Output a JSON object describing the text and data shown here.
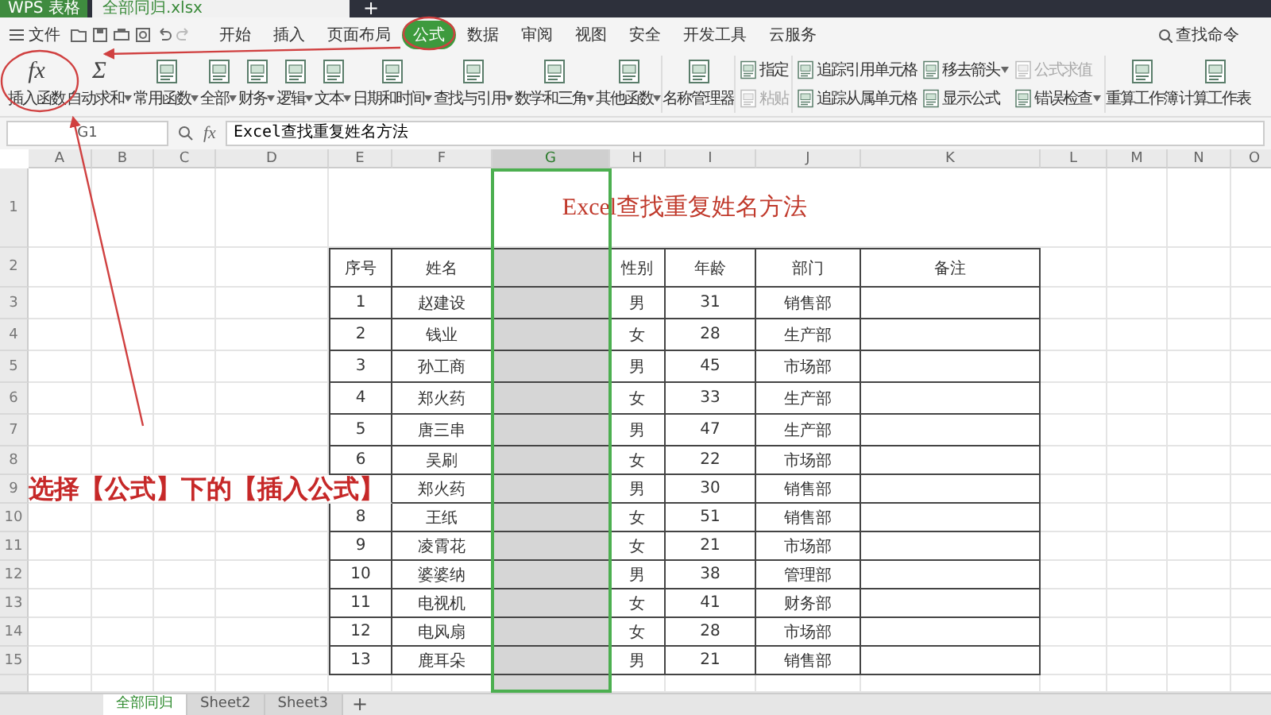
{
  "title_bar": {
    "app_tab": "WPS 表格",
    "doc_tab": "全部同归.xlsx",
    "new_tab": "+"
  },
  "menu": {
    "file": "文件",
    "tabs": [
      {
        "label": "开始",
        "selected": false
      },
      {
        "label": "插入",
        "selected": false
      },
      {
        "label": "页面布局",
        "selected": false
      },
      {
        "label": "公式",
        "selected": true,
        "circled": true
      },
      {
        "label": "数据",
        "selected": false
      },
      {
        "label": "审阅",
        "selected": false
      },
      {
        "label": "视图",
        "selected": false
      },
      {
        "label": "安全",
        "selected": false
      },
      {
        "label": "开发工具",
        "selected": false
      },
      {
        "label": "云服务",
        "selected": false
      }
    ],
    "search": "查找命令"
  },
  "ribbon": {
    "sections": [
      {
        "kind": "large",
        "items": [
          {
            "label": "插入函数",
            "glyph": "fx",
            "circled": true
          },
          {
            "label": "自动求和",
            "glyph": "Σ",
            "dropdown": true
          },
          {
            "label": "常用函数",
            "dropdown": true
          },
          {
            "label": "全部",
            "dropdown": true
          },
          {
            "label": "财务",
            "dropdown": true
          },
          {
            "label": "逻辑",
            "dropdown": true
          },
          {
            "label": "文本",
            "dropdown": true
          },
          {
            "label": "日期和时间",
            "dropdown": true
          },
          {
            "label": "查找与引用",
            "dropdown": true
          },
          {
            "label": "数学和三角",
            "dropdown": true
          },
          {
            "label": "其他函数",
            "dropdown": true
          }
        ]
      },
      {
        "kind": "large",
        "items": [
          {
            "label": "名称管理器"
          }
        ]
      },
      {
        "kind": "stack",
        "items": [
          {
            "label": "指定"
          },
          {
            "label": "粘贴",
            "disabled": true
          }
        ]
      },
      {
        "kind": "stack",
        "items": [
          {
            "label": "追踪引用单元格"
          },
          {
            "label": "追踪从属单元格"
          },
          {
            "label": "移去箭头",
            "dropdown": true
          },
          {
            "label": "显示公式"
          },
          {
            "label": "公式求值",
            "disabled": true
          },
          {
            "label": "错误检查",
            "dropdown": true
          }
        ]
      },
      {
        "kind": "large",
        "items": [
          {
            "label": "重算工作簿"
          },
          {
            "label": "计算工作表"
          }
        ]
      }
    ]
  },
  "formula_bar": {
    "name_box": "G1",
    "fx": "fx",
    "formula": "Excel查找重复姓名方法"
  },
  "sheet": {
    "columns": [
      {
        "label": "A",
        "selected": false
      },
      {
        "label": "B",
        "selected": false
      },
      {
        "label": "C",
        "selected": false
      },
      {
        "label": "D",
        "selected": false
      },
      {
        "label": "E",
        "selected": false
      },
      {
        "label": "F",
        "selected": false
      },
      {
        "label": "G",
        "selected": true
      },
      {
        "label": "H",
        "selected": false
      },
      {
        "label": "I",
        "selected": false
      },
      {
        "label": "J",
        "selected": false
      },
      {
        "label": "K",
        "selected": false
      },
      {
        "label": "L",
        "selected": false
      },
      {
        "label": "M",
        "selected": false
      },
      {
        "label": "N",
        "selected": false
      },
      {
        "label": "O",
        "selected": false
      }
    ],
    "row_numbers": [
      "1",
      "2",
      "3",
      "4",
      "5",
      "6",
      "7",
      "8",
      "9",
      "10",
      "11",
      "12",
      "13",
      "14",
      "15"
    ],
    "title": "Excel查找重复姓名方法",
    "table": {
      "header": {
        "num": "序号",
        "name": "姓名",
        "gender": "性别",
        "age": "年龄",
        "dept": "部门",
        "note": "备注"
      },
      "rows": [
        {
          "num": "1",
          "name": "赵建设",
          "gender": "男",
          "age": "31",
          "dept": "销售部"
        },
        {
          "num": "2",
          "name": "钱业",
          "gender": "女",
          "age": "28",
          "dept": "生产部"
        },
        {
          "num": "3",
          "name": "孙工商",
          "gender": "男",
          "age": "45",
          "dept": "市场部"
        },
        {
          "num": "4",
          "name": "郑火药",
          "gender": "女",
          "age": "33",
          "dept": "生产部"
        },
        {
          "num": "5",
          "name": "唐三串",
          "gender": "男",
          "age": "47",
          "dept": "生产部"
        },
        {
          "num": "6",
          "name": "吴刷",
          "gender": "女",
          "age": "22",
          "dept": "市场部"
        },
        {
          "name": "郑火药",
          "gender": "男",
          "age": "30",
          "dept": "销售部"
        },
        {
          "num": "8",
          "name": "王纸",
          "gender": "女",
          "age": "51",
          "dept": "销售部"
        },
        {
          "num": "9",
          "name": "凌霄花",
          "gender": "女",
          "age": "21",
          "dept": "市场部"
        },
        {
          "num": "10",
          "name": "婆婆纳",
          "gender": "男",
          "age": "38",
          "dept": "管理部"
        },
        {
          "num": "11",
          "name": "电视机",
          "gender": "女",
          "age": "41",
          "dept": "财务部"
        },
        {
          "num": "12",
          "name": "电风扇",
          "gender": "女",
          "age": "28",
          "dept": "市场部"
        },
        {
          "num": "13",
          "name": "鹿耳朵",
          "gender": "男",
          "age": "21",
          "dept": "销售部"
        }
      ]
    },
    "annotation": "选择【公式】下的【插入公式】"
  },
  "sheet_tabs": {
    "tabs": [
      {
        "label": "全部同归",
        "selected": true
      },
      {
        "label": "Sheet2",
        "selected": false
      },
      {
        "label": "Sheet3",
        "selected": false
      }
    ],
    "add": "+"
  }
}
